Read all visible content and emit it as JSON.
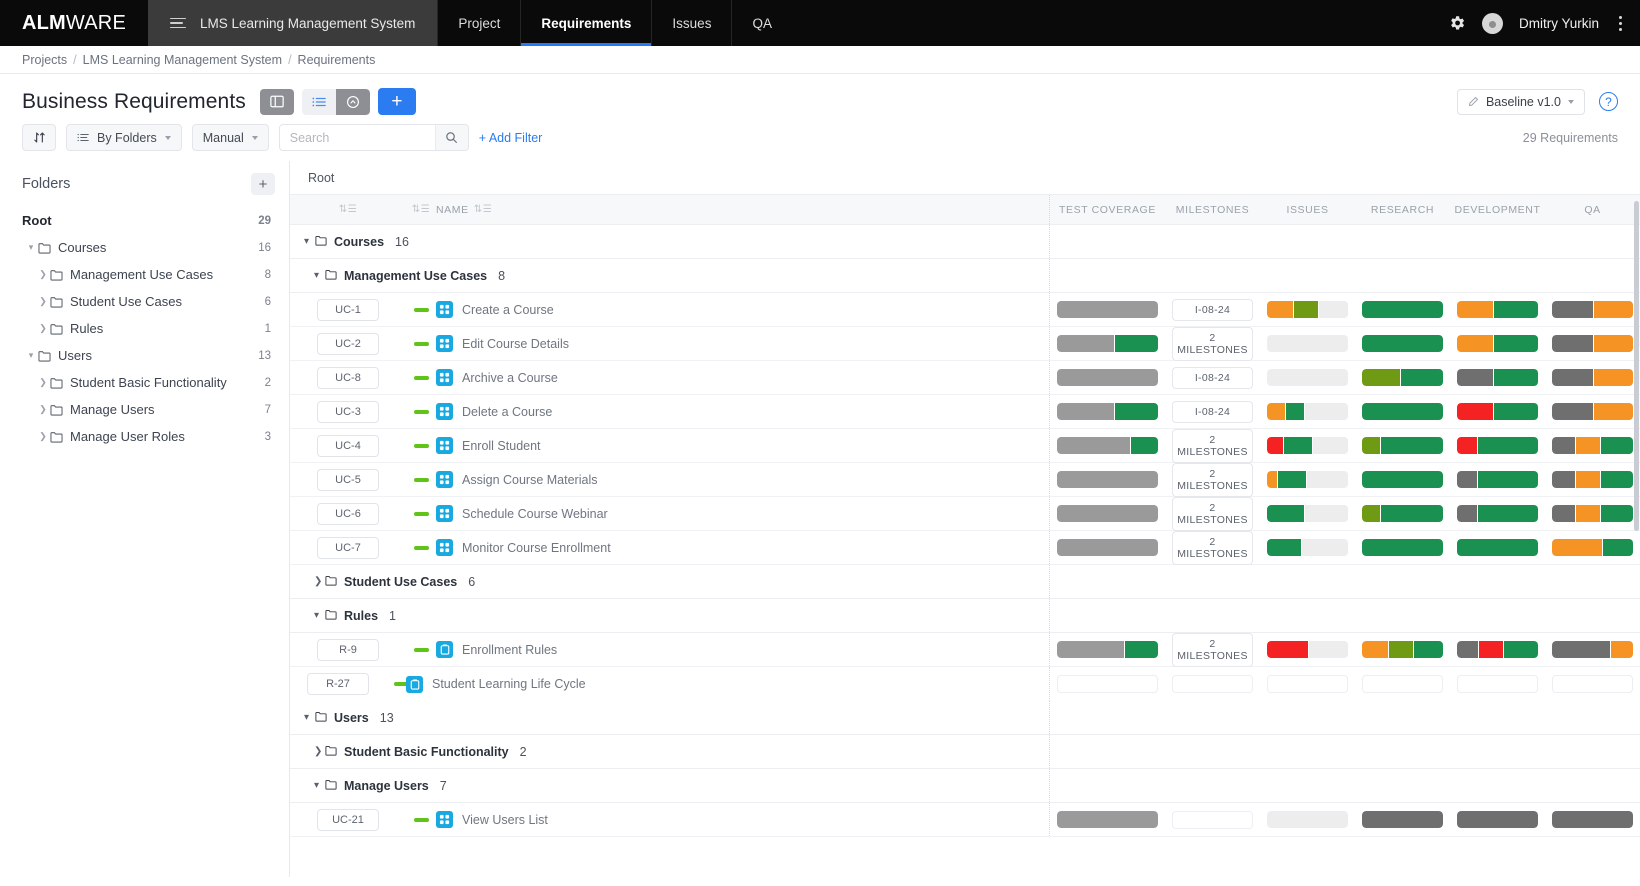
{
  "topbar": {
    "brand_bold": "ALM",
    "brand_light": "WARE",
    "project": "LMS Learning Management System",
    "nav": [
      {
        "label": "Project",
        "active": false
      },
      {
        "label": "Requirements",
        "active": true
      },
      {
        "label": "Issues",
        "active": false
      },
      {
        "label": "QA",
        "active": false
      }
    ],
    "user": "Dmitry Yurkin",
    "gear_icon": "gear-icon",
    "kebab_icon": "more-vertical-icon"
  },
  "breadcrumb": {
    "items": [
      "Projects",
      "LMS Learning Management System",
      "Requirements"
    ],
    "separator": "/"
  },
  "page": {
    "title": "Business Requirements",
    "view_buttons": [
      {
        "name": "panel-view",
        "icon": "panel-icon",
        "state": "dark"
      },
      {
        "name": "list-view",
        "icon": "list-icon",
        "state": "light"
      },
      {
        "name": "gauge-view",
        "icon": "gauge-icon",
        "state": "dark"
      }
    ],
    "add_label": "+",
    "baseline_label": "Baseline v1.0",
    "help_label": "?"
  },
  "filters": {
    "sort_label": "",
    "group_label": "By Folders",
    "order_label": "Manual",
    "search_placeholder": "Search",
    "search_value": "",
    "add_filter_label": "+ Add Filter",
    "requirements_count": "29 Requirements"
  },
  "sidebar": {
    "title": "Folders",
    "add_label": "+",
    "items": [
      {
        "label": "Root",
        "count": "29",
        "level": 0,
        "expanded": true,
        "has_arrow": false
      },
      {
        "label": "Courses",
        "count": "16",
        "level": 1,
        "expanded": true,
        "has_arrow": true
      },
      {
        "label": "Management Use Cases",
        "count": "8",
        "level": 2,
        "expanded": false,
        "has_arrow": true
      },
      {
        "label": "Student Use Cases",
        "count": "6",
        "level": 2,
        "expanded": false,
        "has_arrow": true
      },
      {
        "label": "Rules",
        "count": "1",
        "level": 2,
        "expanded": false,
        "has_arrow": true
      },
      {
        "label": "Users",
        "count": "13",
        "level": 1,
        "expanded": true,
        "has_arrow": true
      },
      {
        "label": "Student Basic Functionality",
        "count": "2",
        "level": 2,
        "expanded": false,
        "has_arrow": true
      },
      {
        "label": "Manage Users",
        "count": "7",
        "level": 2,
        "expanded": false,
        "has_arrow": true
      },
      {
        "label": "Manage User Roles",
        "count": "3",
        "level": 2,
        "expanded": false,
        "has_arrow": true
      }
    ]
  },
  "grid": {
    "root_label": "Root",
    "columns": [
      "NAME",
      "TEST COVERAGE",
      "MILESTONES",
      "ISSUES",
      "RESEARCH",
      "DEVELOPMENT",
      "QA"
    ],
    "colors": {
      "green": "#1a9150",
      "olive": "#6f9a13",
      "orange": "#f59324",
      "red": "#f42222",
      "gray": "#6f6f6f",
      "gray_light": "#9a9a9a",
      "empty": "#ededed",
      "accent": "#2a7cf0",
      "priority": "#5fc417"
    },
    "rows": [
      {
        "kind": "folder",
        "label": "Courses",
        "count": "16",
        "indent": 0,
        "expanded": true
      },
      {
        "kind": "folder",
        "label": "Management Use Cases",
        "count": "8",
        "indent": 1,
        "expanded": true
      },
      {
        "kind": "item",
        "id": "UC-1",
        "name": "Create a Course",
        "icon": "usecase-icon",
        "indent": 2,
        "test_coverage": [
          [
            "#9a9a9a",
            100
          ]
        ],
        "milestones": "I-08-24",
        "issues": [
          [
            "#f59324",
            32
          ],
          [
            "#6f9a13",
            30
          ],
          [
            "#ededed",
            38
          ]
        ],
        "research": [
          [
            "#1a9150",
            100
          ]
        ],
        "development": [
          [
            "#f59324",
            45
          ],
          [
            "#1a9150",
            55
          ]
        ],
        "qa": [
          [
            "#6f6f6f",
            50
          ],
          [
            "#f59324",
            50
          ]
        ]
      },
      {
        "kind": "item",
        "id": "UC-2",
        "name": "Edit Course Details",
        "icon": "usecase-icon",
        "indent": 2,
        "test_coverage": [
          [
            "#9a9a9a",
            56
          ],
          [
            "#1a9150",
            44
          ]
        ],
        "milestones": "2 MILESTONES",
        "issues": [
          [
            "#ededed",
            100
          ]
        ],
        "research": [
          [
            "#1a9150",
            100
          ]
        ],
        "development": [
          [
            "#f59324",
            45
          ],
          [
            "#1a9150",
            55
          ]
        ],
        "qa": [
          [
            "#6f6f6f",
            50
          ],
          [
            "#f59324",
            50
          ]
        ]
      },
      {
        "kind": "item",
        "id": "UC-8",
        "name": "Archive a Course",
        "icon": "usecase-icon",
        "indent": 2,
        "test_coverage": [
          [
            "#9a9a9a",
            100
          ]
        ],
        "milestones": "I-08-24",
        "issues": [
          [
            "#ededed",
            100
          ]
        ],
        "research": [
          [
            "#6f9a13",
            47
          ],
          [
            "#1a9150",
            53
          ]
        ],
        "development": [
          [
            "#6f6f6f",
            45
          ],
          [
            "#1a9150",
            55
          ]
        ],
        "qa": [
          [
            "#6f6f6f",
            50
          ],
          [
            "#f59324",
            50
          ]
        ]
      },
      {
        "kind": "item",
        "id": "UC-3",
        "name": "Delete a Course",
        "icon": "usecase-icon",
        "indent": 2,
        "test_coverage": [
          [
            "#9a9a9a",
            56
          ],
          [
            "#1a9150",
            44
          ]
        ],
        "milestones": "I-08-24",
        "issues": [
          [
            "#f59324",
            22
          ],
          [
            "#1a9150",
            22
          ],
          [
            "#ededed",
            56
          ]
        ],
        "research": [
          [
            "#1a9150",
            100
          ]
        ],
        "development": [
          [
            "#f42222",
            45
          ],
          [
            "#1a9150",
            55
          ]
        ],
        "qa": [
          [
            "#6f6f6f",
            50
          ],
          [
            "#f59324",
            50
          ]
        ]
      },
      {
        "kind": "item",
        "id": "UC-4",
        "name": "Enroll Student",
        "icon": "usecase-icon",
        "indent": 2,
        "test_coverage": [
          [
            "#9a9a9a",
            72
          ],
          [
            "#1a9150",
            28
          ]
        ],
        "milestones": "2 MILESTONES",
        "issues": [
          [
            "#f42222",
            20
          ],
          [
            "#1a9150",
            34
          ],
          [
            "#ededed",
            46
          ]
        ],
        "research": [
          [
            "#6f9a13",
            22
          ],
          [
            "#1a9150",
            78
          ]
        ],
        "development": [
          [
            "#f42222",
            25
          ],
          [
            "#1a9150",
            75
          ]
        ],
        "qa": [
          [
            "#6f6f6f",
            28
          ],
          [
            "#f59324",
            30
          ],
          [
            "#1a9150",
            42
          ]
        ]
      },
      {
        "kind": "item",
        "id": "UC-5",
        "name": "Assign Course Materials",
        "icon": "usecase-icon",
        "indent": 2,
        "test_coverage": [
          [
            "#9a9a9a",
            100
          ]
        ],
        "milestones": "2 MILESTONES",
        "issues": [
          [
            "#f59324",
            12
          ],
          [
            "#1a9150",
            35
          ],
          [
            "#ededed",
            53
          ]
        ],
        "research": [
          [
            "#1a9150",
            100
          ]
        ],
        "development": [
          [
            "#6f6f6f",
            25
          ],
          [
            "#1a9150",
            75
          ]
        ],
        "qa": [
          [
            "#6f6f6f",
            28
          ],
          [
            "#f59324",
            30
          ],
          [
            "#1a9150",
            42
          ]
        ]
      },
      {
        "kind": "item",
        "id": "UC-6",
        "name": "Schedule Course Webinar",
        "icon": "usecase-icon",
        "indent": 2,
        "test_coverage": [
          [
            "#9a9a9a",
            100
          ]
        ],
        "milestones": "2 MILESTONES",
        "issues": [
          [
            "#1a9150",
            46
          ],
          [
            "#ededed",
            54
          ]
        ],
        "research": [
          [
            "#6f9a13",
            22
          ],
          [
            "#1a9150",
            78
          ]
        ],
        "development": [
          [
            "#6f6f6f",
            25
          ],
          [
            "#1a9150",
            75
          ]
        ],
        "qa": [
          [
            "#6f6f6f",
            28
          ],
          [
            "#f59324",
            30
          ],
          [
            "#1a9150",
            42
          ]
        ]
      },
      {
        "kind": "item",
        "id": "UC-7",
        "name": "Monitor Course Enrollment",
        "icon": "usecase-icon",
        "indent": 2,
        "test_coverage": [
          [
            "#9a9a9a",
            100
          ]
        ],
        "milestones": "2 MILESTONES",
        "issues": [
          [
            "#1a9150",
            42
          ],
          [
            "#ededed",
            58
          ]
        ],
        "research": [
          [
            "#1a9150",
            100
          ]
        ],
        "development": [
          [
            "#1a9150",
            100
          ]
        ],
        "qa": [
          [
            "#f59324",
            62
          ],
          [
            "#1a9150",
            38
          ]
        ]
      },
      {
        "kind": "folder",
        "label": "Student Use Cases",
        "count": "6",
        "indent": 1,
        "expanded": false
      },
      {
        "kind": "folder",
        "label": "Rules",
        "count": "1",
        "indent": 1,
        "expanded": true
      },
      {
        "kind": "item",
        "id": "R-9",
        "name": "Enrollment Rules",
        "icon": "rule-icon",
        "indent": 2,
        "test_coverage": [
          [
            "#9a9a9a",
            66
          ],
          [
            "#1a9150",
            34
          ]
        ],
        "milestones": "2 MILESTONES",
        "issues": [
          [
            "#f42222",
            50
          ],
          [
            "#ededed",
            50
          ]
        ],
        "research": [
          [
            "#f59324",
            32
          ],
          [
            "#6f9a13",
            30
          ],
          [
            "#1a9150",
            38
          ]
        ],
        "development": [
          [
            "#6f6f6f",
            26
          ],
          [
            "#f42222",
            30
          ],
          [
            "#1a9150",
            44
          ]
        ],
        "qa": [
          [
            "#6f6f6f",
            72
          ],
          [
            "#f59324",
            28
          ]
        ]
      },
      {
        "kind": "item",
        "id": "R-27",
        "name": "Student Learning Life Cycle",
        "icon": "rule-icon",
        "indent": 1,
        "dragging": true,
        "test_coverage": [],
        "milestones": "",
        "issues": [],
        "research": [],
        "development": [],
        "qa": []
      },
      {
        "kind": "folder",
        "label": "Users",
        "count": "13",
        "indent": 0,
        "expanded": true
      },
      {
        "kind": "folder",
        "label": "Student Basic Functionality",
        "count": "2",
        "indent": 1,
        "expanded": false
      },
      {
        "kind": "folder",
        "label": "Manage Users",
        "count": "7",
        "indent": 1,
        "expanded": true
      },
      {
        "kind": "item",
        "id": "UC-21",
        "name": "View Users List",
        "icon": "usecase-icon",
        "indent": 2,
        "test_coverage": [
          [
            "#9a9a9a",
            100
          ]
        ],
        "milestones": "",
        "issues": [
          [
            "#ededed",
            100
          ]
        ],
        "research": [
          [
            "#6f6f6f",
            100
          ]
        ],
        "development": [
          [
            "#6f6f6f",
            100
          ]
        ],
        "qa": [
          [
            "#6f6f6f",
            100
          ]
        ]
      }
    ]
  }
}
